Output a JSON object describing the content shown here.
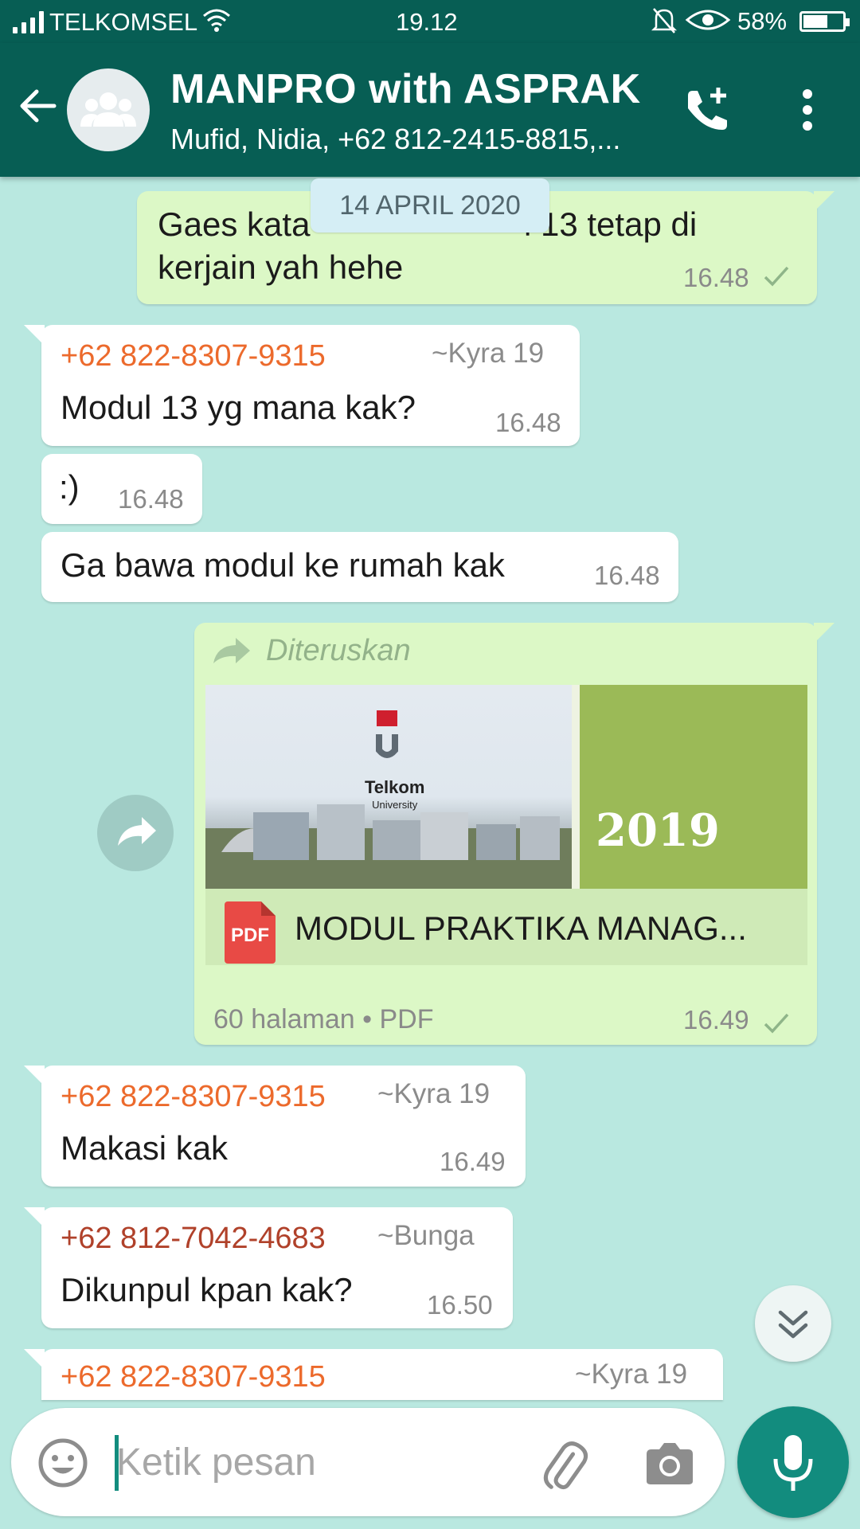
{
  "status_bar": {
    "carrier": "TELKOMSEL",
    "time": "19.12",
    "battery": "58%",
    "battery_level": 0.58
  },
  "header": {
    "title": "MANPRO with ASPRAK",
    "subtitle": "Mufid, Nidia, +62 812-2415-8815,..."
  },
  "chat": {
    "date_label": "14 APRIL 2020",
    "messages": [
      {
        "type": "outgoing",
        "text_line1": "Gaes kata",
        "text_line1_end": "l 13 tetap di",
        "text_line2": "kerjain yah hehe",
        "time": "16.48"
      },
      {
        "type": "incoming",
        "sender": "+62 822-8307-9315",
        "alias": "~Kyra 19",
        "text": "Modul 13 yg mana kak?",
        "time": "16.48"
      },
      {
        "type": "incoming",
        "text": ":)",
        "time": "16.48"
      },
      {
        "type": "incoming",
        "text": "Ga bawa modul ke rumah kak",
        "time": "16.48"
      },
      {
        "type": "outgoing_document",
        "forwarded_label": "Diteruskan",
        "thumbnail_year": "2019",
        "logo_text": "Telkom",
        "logo_subtext": "University",
        "file_icon_label": "PDF",
        "file_name": "MODUL PRAKTIKA MANAG...",
        "meta": "60 halaman • PDF",
        "time": "16.49"
      },
      {
        "type": "incoming",
        "sender": "+62 822-8307-9315",
        "alias": "~Kyra 19",
        "text": "Makasi kak",
        "time": "16.49"
      },
      {
        "type": "incoming",
        "sender": "+62 812-7042-4683",
        "alias": "~Bunga",
        "text": "Dikunpul kpan kak?",
        "time": "16.50"
      },
      {
        "type": "incoming_partial",
        "sender": "+62 822-8307-9315",
        "alias": "~Kyra 19"
      }
    ]
  },
  "composer": {
    "placeholder": "Ketik pesan"
  },
  "colors": {
    "header": "#075e54",
    "accent": "#128c7e",
    "outgoing_bubble": "#dcf8c6",
    "chat_background": "#b9e8e0"
  }
}
